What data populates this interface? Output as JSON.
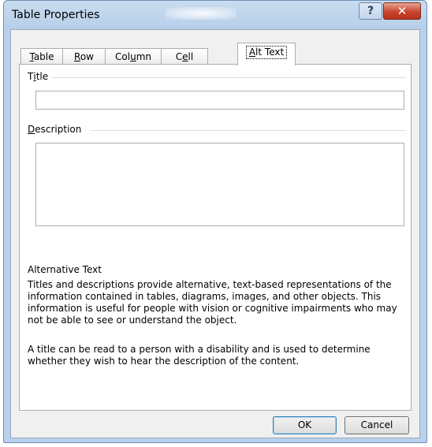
{
  "window": {
    "title": "Table Properties",
    "help_glyph": "?",
    "close_glyph": "✕"
  },
  "tabs": [
    {
      "pre": "",
      "key": "T",
      "post": "able"
    },
    {
      "pre": "",
      "key": "R",
      "post": "ow"
    },
    {
      "pre": "Col",
      "key": "u",
      "post": "mn"
    },
    {
      "pre": "C",
      "key": "e",
      "post": "ll"
    },
    {
      "pre": "",
      "key": "A",
      "post": "lt Text"
    }
  ],
  "active_tab_index": 4,
  "alt_text": {
    "title_label": {
      "pre": "T",
      "key": "i",
      "post": "tle"
    },
    "title_value": "",
    "description_label": {
      "pre": "",
      "key": "D",
      "post": "escription"
    },
    "description_value": "",
    "heading": "Alternative Text",
    "paragraph1": "Titles and descriptions provide alternative, text-based representations of the information contained in tables, diagrams, images, and other objects. This information is useful for people with vision or cognitive impairments who may not be able to see or understand the object.",
    "paragraph2": "A title can be read to a person with a disability and is used to determine whether they wish to hear the description of the content."
  },
  "buttons": {
    "ok": "OK",
    "cancel": "Cancel"
  }
}
